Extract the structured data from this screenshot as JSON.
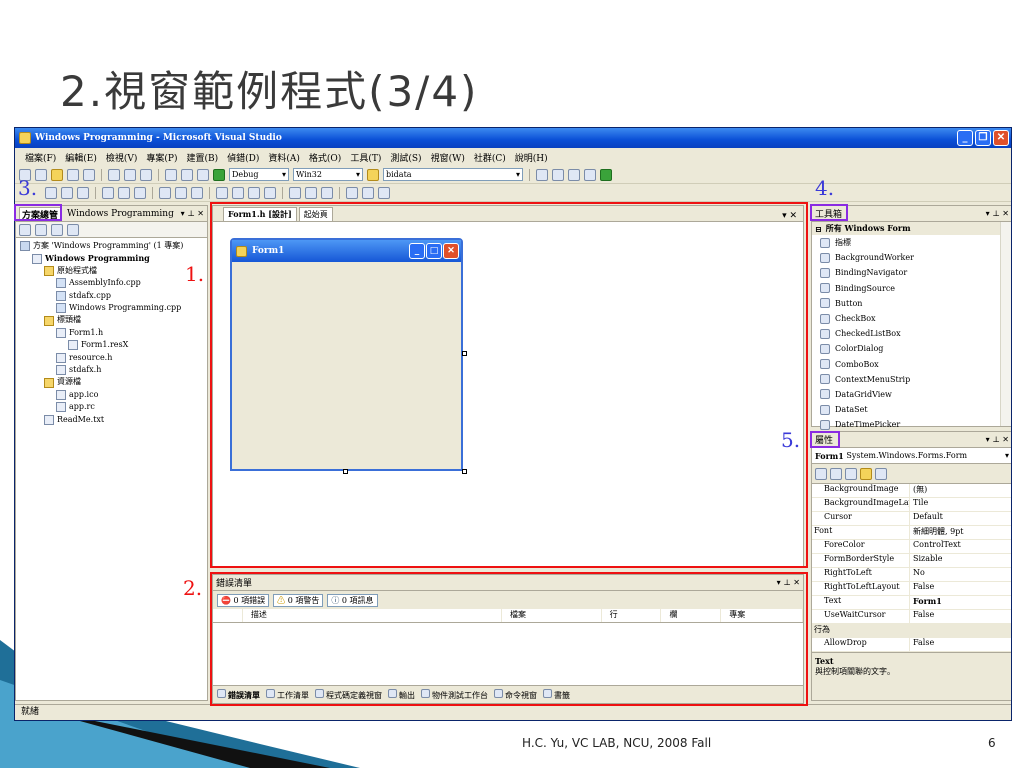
{
  "slide": {
    "title": "2.視窗範例程式(3/4)",
    "footer": "H.C. Yu, VC LAB, NCU, 2008 Fall",
    "page": "6"
  },
  "window": {
    "title": "Windows Programming - Microsoft Visual Studio",
    "menu": [
      "檔案(F)",
      "編輯(E)",
      "檢視(V)",
      "專案(P)",
      "建置(B)",
      "偵錯(D)",
      "資料(A)",
      "格式(O)",
      "工具(T)",
      "測試(S)",
      "視窗(W)",
      "社群(C)",
      "說明(H)"
    ],
    "config": "Debug",
    "platform": "Win32",
    "search_value": "bidata",
    "status": "就緒"
  },
  "solution": {
    "tab_active": "方案總管",
    "tab_other": "Windows Programming",
    "items": [
      {
        "label": "方案 'Windows Programming' (1 專案)",
        "depth": 0,
        "icon": "solution"
      },
      {
        "label": "Windows Programming",
        "depth": 1,
        "icon": "project",
        "bold": true
      },
      {
        "label": "原始程式檔",
        "depth": 2,
        "icon": "folder"
      },
      {
        "label": "AssemblyInfo.cpp",
        "depth": 3,
        "icon": "cpp"
      },
      {
        "label": "stdafx.cpp",
        "depth": 3,
        "icon": "cpp"
      },
      {
        "label": "Windows Programming.cpp",
        "depth": 3,
        "icon": "cpp"
      },
      {
        "label": "標頭檔",
        "depth": 2,
        "icon": "folder"
      },
      {
        "label": "Form1.h",
        "depth": 3,
        "icon": "form"
      },
      {
        "label": "Form1.resX",
        "depth": 4,
        "icon": "resx"
      },
      {
        "label": "resource.h",
        "depth": 3,
        "icon": "h"
      },
      {
        "label": "stdafx.h",
        "depth": 3,
        "icon": "h"
      },
      {
        "label": "資源檔",
        "depth": 2,
        "icon": "folder"
      },
      {
        "label": "app.ico",
        "depth": 3,
        "icon": "ico"
      },
      {
        "label": "app.rc",
        "depth": 3,
        "icon": "rc"
      },
      {
        "label": "ReadMe.txt",
        "depth": 2,
        "icon": "txt"
      }
    ]
  },
  "editor": {
    "tab_design": "Form1.h [設計]",
    "tab_start": "起始頁",
    "form_title": "Form1"
  },
  "errors": {
    "title": "錯誤清單",
    "errors_btn": "0 項錯誤",
    "warnings_btn": "0 項警告",
    "messages_btn": "0 項訊息",
    "columns": [
      "描述",
      "檔案",
      "行",
      "欄",
      "專案"
    ],
    "bottom_tabs": [
      "錯誤清單",
      "工作清單",
      "程式碼定義視窗",
      "輸出",
      "物件測試工作台",
      "命令視窗",
      "書籤"
    ]
  },
  "toolbox": {
    "title": "工具箱",
    "group": "所有 Windows Form",
    "items": [
      "指標",
      "BackgroundWorker",
      "BindingNavigator",
      "BindingSource",
      "Button",
      "CheckBox",
      "CheckedListBox",
      "ColorDialog",
      "ComboBox",
      "ContextMenuStrip",
      "DataGridView",
      "DataSet",
      "DateTimePicker"
    ]
  },
  "properties": {
    "title": "屬性",
    "object_name": "Form1",
    "object_type": "System.Windows.Forms.Form",
    "rows": [
      {
        "name": "BackgroundImage",
        "value": "(無)"
      },
      {
        "name": "BackgroundImageLayo",
        "value": "Tile"
      },
      {
        "name": "Cursor",
        "value": "Default"
      },
      {
        "name": "Font",
        "value": "新細明體, 9pt"
      },
      {
        "name": "ForeColor",
        "value": "ControlText"
      },
      {
        "name": "FormBorderStyle",
        "value": "Sizable"
      },
      {
        "name": "RightToLeft",
        "value": "No"
      },
      {
        "name": "RightToLeftLayout",
        "value": "False"
      },
      {
        "name": "Text",
        "value": "Form1"
      },
      {
        "name": "UseWaitCursor",
        "value": "False"
      },
      {
        "name": "行為",
        "value": ""
      },
      {
        "name": "AllowDrop",
        "value": "False"
      }
    ],
    "desc_title": "Text",
    "desc_text": "與控制項關聯的文字。"
  },
  "annotations": {
    "red": [
      "1.",
      "2."
    ],
    "blue": [
      "3.",
      "4.",
      "5."
    ]
  },
  "colors": {
    "red": "#ee1111",
    "purple": "#8a2be2",
    "blue_label": "#3b3ad8",
    "xp_blue": "#0a4fd6"
  }
}
